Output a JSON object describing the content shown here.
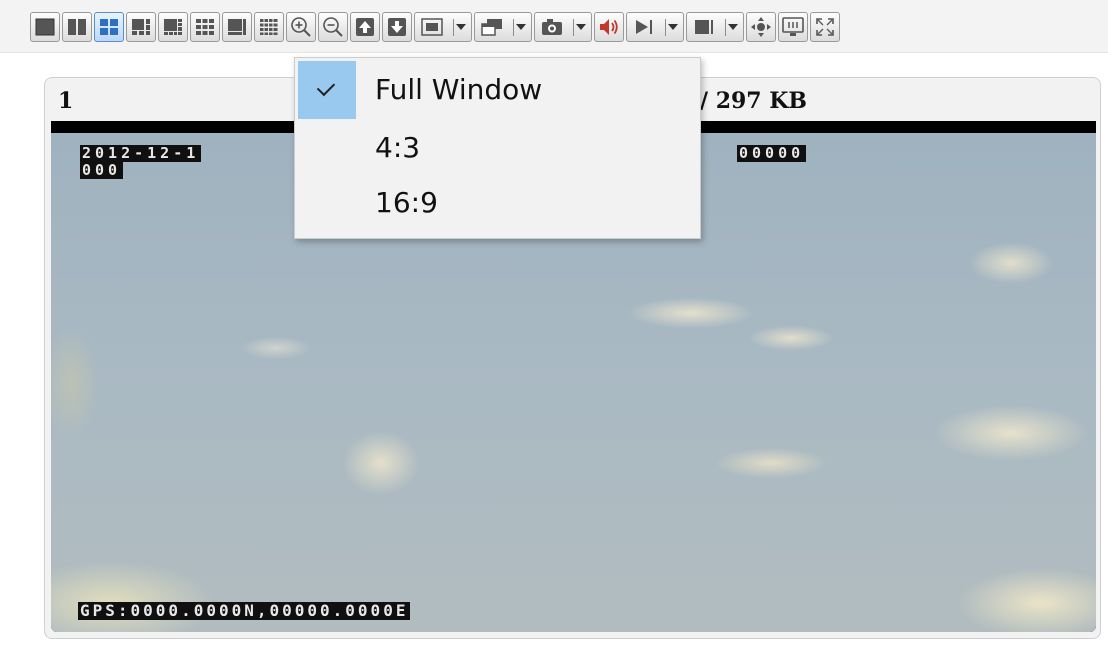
{
  "toolbar": {
    "buttons": [
      {
        "icon": "layout-1-icon"
      },
      {
        "icon": "layout-2-icon"
      },
      {
        "icon": "layout-4-icon",
        "active": true
      },
      {
        "icon": "layout-6-icon"
      },
      {
        "icon": "layout-8-icon"
      },
      {
        "icon": "layout-9-icon"
      },
      {
        "icon": "layout-13-icon"
      },
      {
        "icon": "layout-16-icon"
      },
      {
        "icon": "zoom-in-icon"
      },
      {
        "icon": "zoom-out-icon"
      },
      {
        "icon": "previous-page-icon"
      },
      {
        "icon": "next-page-icon"
      },
      {
        "icon": "aspect-ratio-icon",
        "dropdown": true
      },
      {
        "icon": "window-mode-icon",
        "dropdown": true
      },
      {
        "icon": "snapshot-icon",
        "dropdown": true
      },
      {
        "icon": "audio-icon"
      },
      {
        "icon": "play-icon",
        "dropdown": true
      },
      {
        "icon": "stop-icon",
        "dropdown": true
      },
      {
        "icon": "ptz-icon"
      },
      {
        "icon": "monitor-icon"
      },
      {
        "icon": "fullscreen-icon"
      }
    ]
  },
  "panel": {
    "number": "1",
    "info": "/ 297 KB"
  },
  "video": {
    "osd_date": "2012-12-1",
    "osd_time": "000",
    "osd_right": "00000",
    "osd_gps": "GPS:0000.0000N,00000.0000E"
  },
  "aspect_menu": {
    "items": [
      {
        "label": "Full Window",
        "checked": true
      },
      {
        "label": "4:3",
        "checked": false
      },
      {
        "label": "16:9",
        "checked": false
      }
    ]
  },
  "colors": {
    "menu_highlight": "#99c9ef",
    "active_button": "#5b8fc9",
    "audio_icon": "#c0392b"
  }
}
